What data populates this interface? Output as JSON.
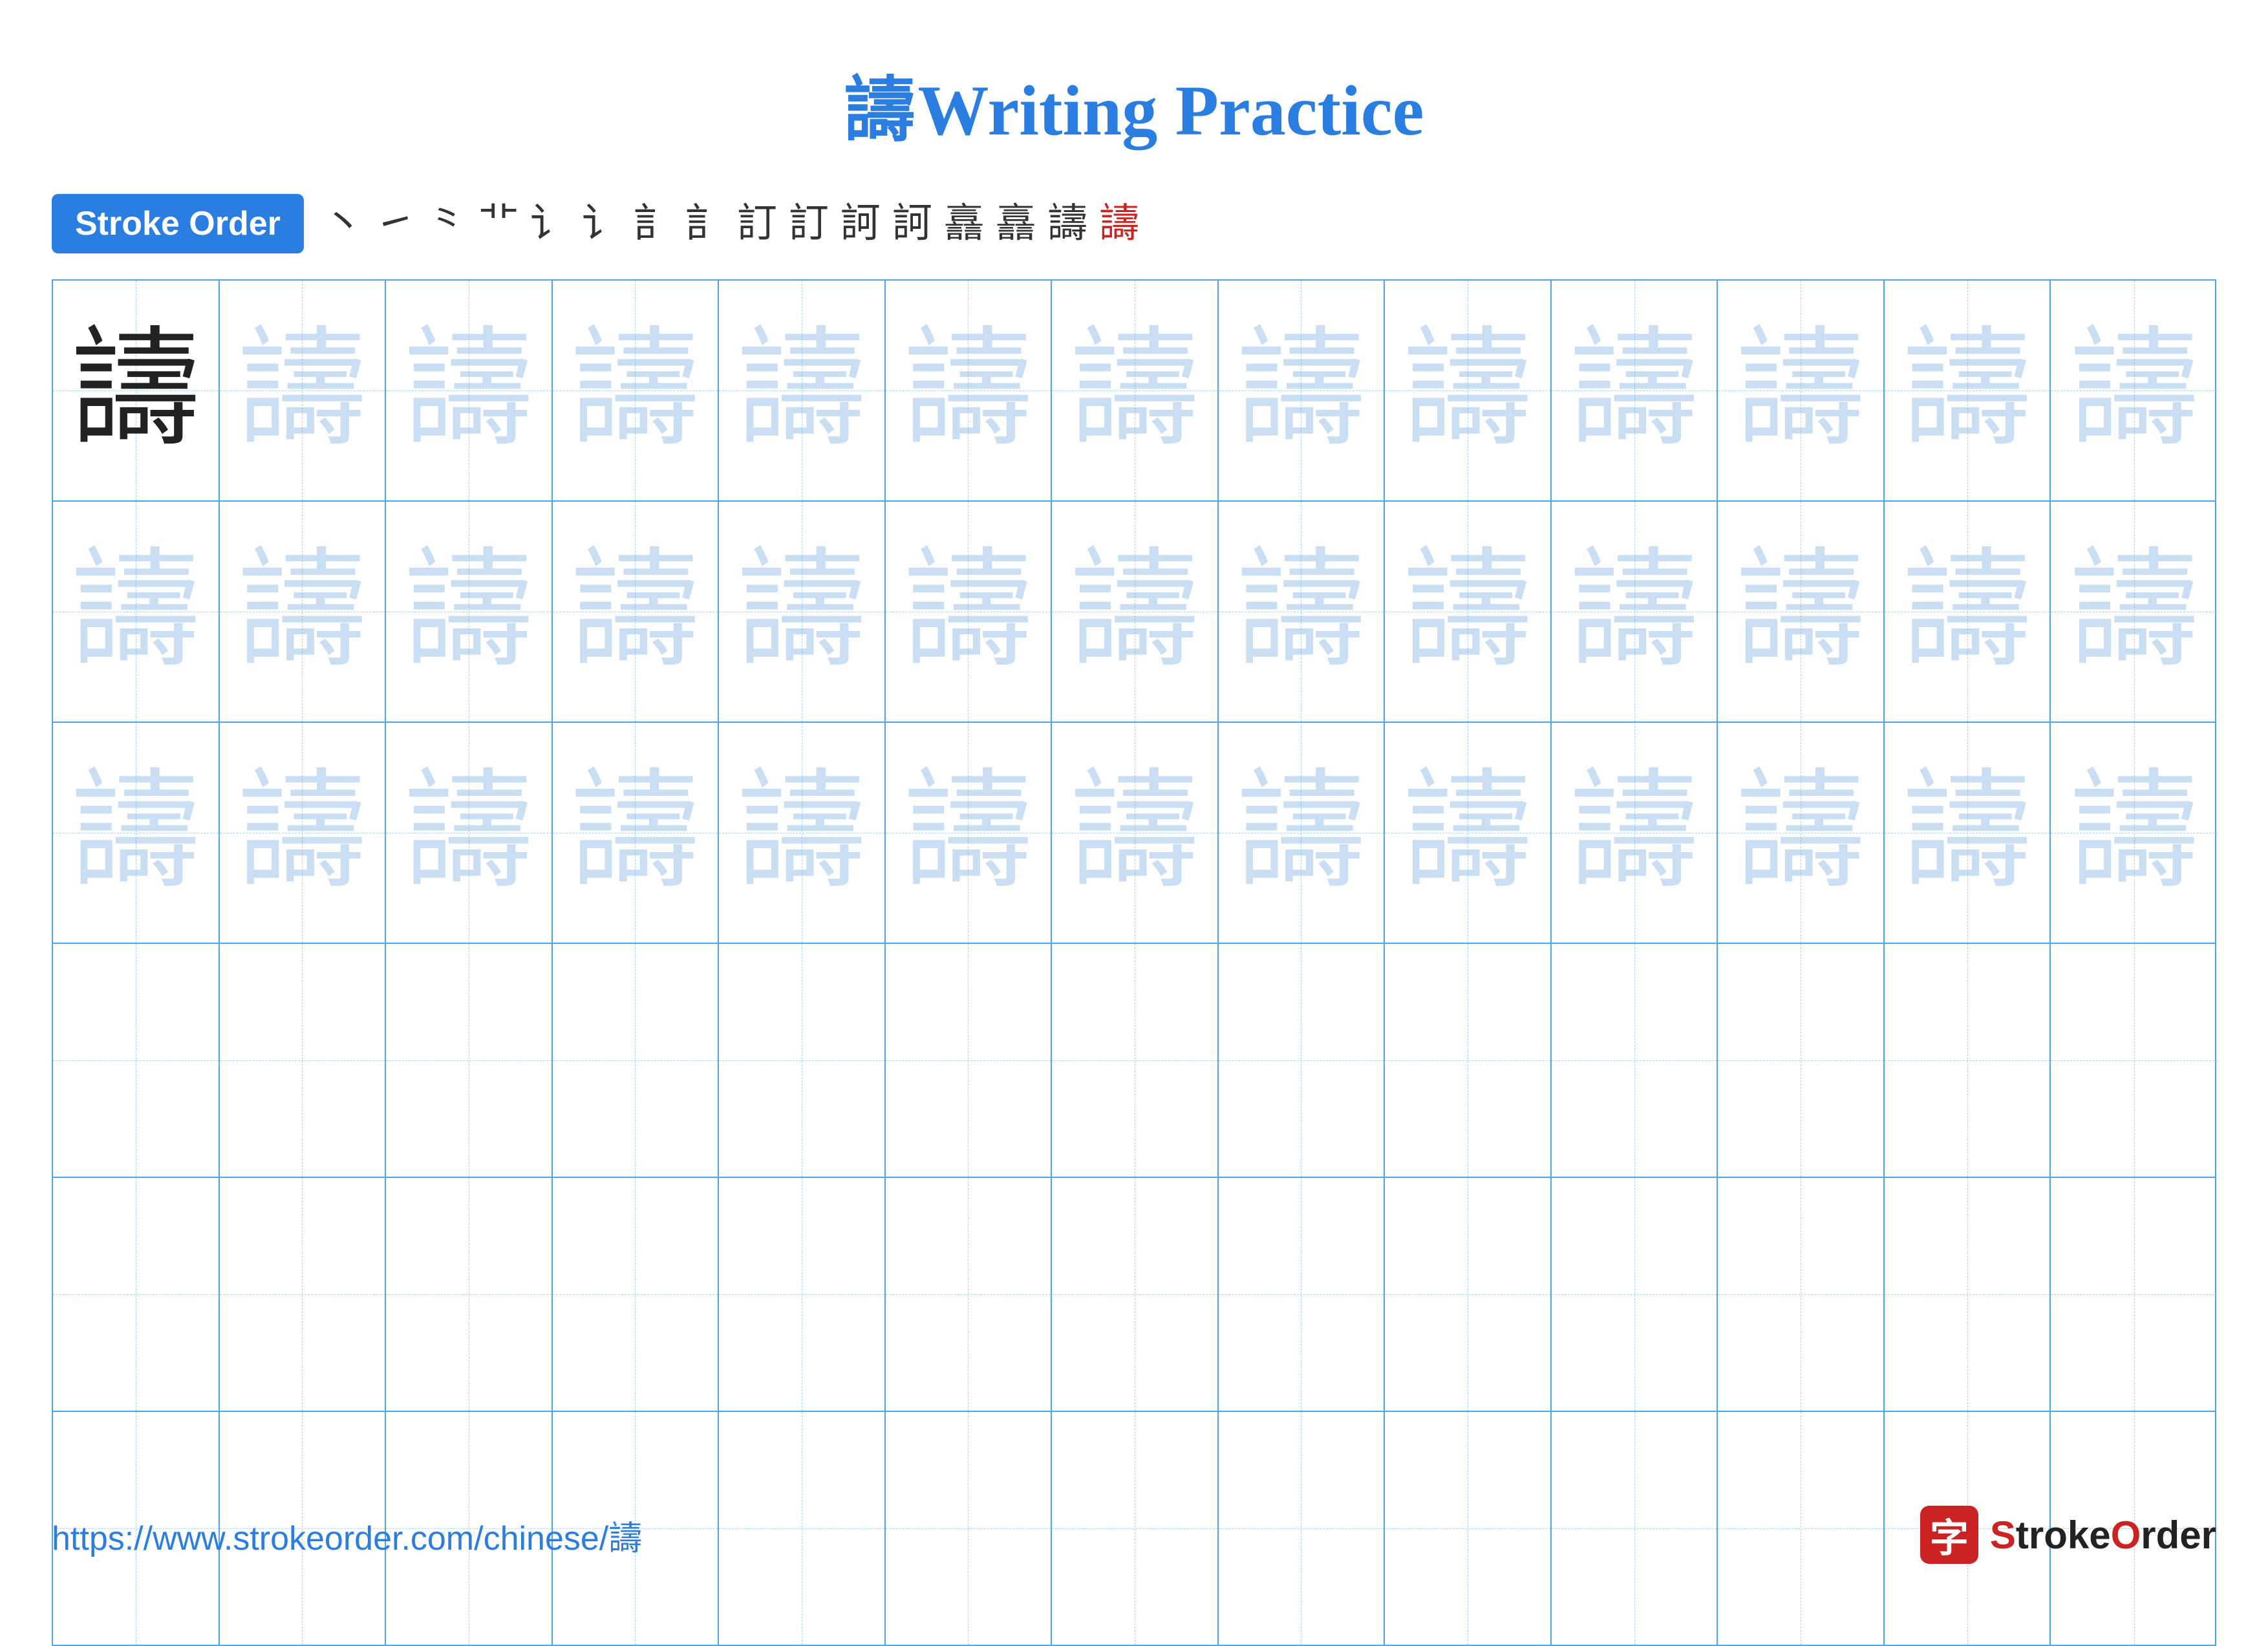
{
  "title": {
    "char": "譸",
    "text": "Writing Practice"
  },
  "stroke_order": {
    "badge": "Stroke Order",
    "steps": [
      "丶",
      "㇀",
      "≡",
      "〓",
      "⾔",
      "⾔+",
      "訁",
      "訁+",
      "訁+",
      "訂",
      "訂+",
      "訂ᵒ",
      "訂ᵒᵒ",
      "訸",
      "訸+",
      "譸"
    ]
  },
  "character": "譸",
  "footer": {
    "url": "https://www.strokeorder.com/chinese/譸",
    "logo_text": "StrokeOrder"
  }
}
